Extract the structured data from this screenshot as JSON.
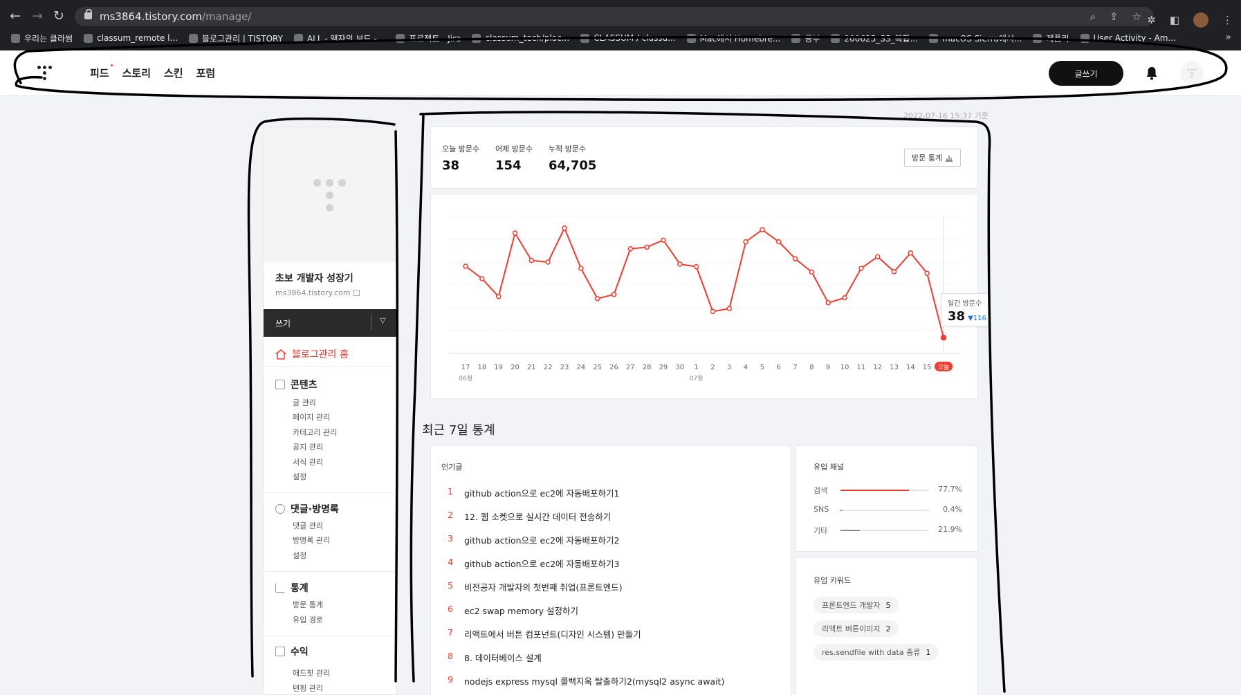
{
  "browser": {
    "url_host": "ms3864.tistory.com",
    "url_path": "/manage/",
    "bookmarks": [
      {
        "label": "우리는 클라썸"
      },
      {
        "label": "classum_remote l..."
      },
      {
        "label": "블로그관리 | TISTORY"
      },
      {
        "label": "ALL - 액자의 보드 -..."
      },
      {
        "label": "프로젝트 - Jira"
      },
      {
        "label": "classum_tech/plac..."
      },
      {
        "label": "CLASSUM / classu..."
      },
      {
        "label": "Mac에서 Homebre..."
      },
      {
        "label": "공부"
      },
      {
        "label": "200625_SS_복합..."
      },
      {
        "label": "macOS Sierra에서..."
      },
      {
        "label": "제품리"
      },
      {
        "label": "User Activity - Am..."
      }
    ],
    "bookmarks_more": "»"
  },
  "topnav": {
    "links": [
      "피드",
      "스토리",
      "스킨",
      "포럼"
    ],
    "write_button": "글쓰기"
  },
  "timestamp": "2022-07-16 15:37 기준",
  "sidebar": {
    "blog_name": "초보 개발자 성장기",
    "blog_url": "ms3864.tistory.com",
    "write_dropdown": "쓰기",
    "home": "블로그관리 홈",
    "sections": [
      {
        "title": "콘텐츠",
        "items": [
          "글 관리",
          "페이지 관리",
          "카테고리 관리",
          "공지 관리",
          "서식 관리",
          "설정"
        ]
      },
      {
        "title": "댓글·방명록",
        "items": [
          "댓글 관리",
          "방명록 관리",
          "설정"
        ]
      },
      {
        "title": "통계",
        "items": [
          "방문 통계",
          "유입 경로"
        ]
      },
      {
        "title": "수익",
        "items": [
          "애드핏 관리",
          "텐핑 관리"
        ]
      }
    ]
  },
  "summary": {
    "today_label": "오늘 방문수",
    "today_value": "38",
    "yesterday_label": "어제 방문수",
    "yesterday_value": "154",
    "total_label": "누적 방문수",
    "total_value": "64,705",
    "stats_button": "방문 통계"
  },
  "chart_data": {
    "type": "line",
    "x": [
      "17",
      "18",
      "19",
      "20",
      "21",
      "22",
      "23",
      "24",
      "25",
      "26",
      "27",
      "28",
      "29",
      "30",
      "1",
      "2",
      "3",
      "4",
      "5",
      "6",
      "7",
      "8",
      "9",
      "10",
      "11",
      "12",
      "13",
      "14",
      "15",
      "오늘"
    ],
    "month_labels": [
      {
        "at": "17",
        "label": "06월"
      },
      {
        "at": "1",
        "label": "07월"
      }
    ],
    "series": [
      {
        "values": [
          210,
          180,
          137,
          290,
          224,
          220,
          302,
          205,
          132,
          142,
          252,
          256,
          273,
          215,
          209,
          101,
          108,
          269,
          298,
          269,
          228,
          196,
          122,
          134,
          205,
          233,
          197,
          242,
          193,
          38
        ],
        "color": "#f53b2d"
      }
    ],
    "ylim": [
      0,
      330
    ],
    "grid": true,
    "tooltip": {
      "label": "일간 방문수",
      "value": "38",
      "delta": "▼116"
    }
  },
  "recent": {
    "title": "최근 7일 통계",
    "popular_title": "인기글",
    "posts": [
      {
        "rank": "1",
        "title": "github action으로 ec2에 자동배포하기1"
      },
      {
        "rank": "2",
        "title": "12. 웹 소켓으로 실시간 데이터 전송하기"
      },
      {
        "rank": "3",
        "title": "github action으로 ec2에 자동배포하기2"
      },
      {
        "rank": "4",
        "title": "github action으로 ec2에 자동배포하기3"
      },
      {
        "rank": "5",
        "title": "비전공자 개발자의 첫번째 취업(프론트엔드)"
      },
      {
        "rank": "6",
        "title": "ec2 swap memory 설정하기"
      },
      {
        "rank": "7",
        "title": "리액트에서 버튼 컴포넌트(디자인 시스템) 만들기"
      },
      {
        "rank": "8",
        "title": "8. 데이터베이스 설계"
      },
      {
        "rank": "9",
        "title": "nodejs express mysql 콜백지옥 탈출하기2(mysql2 async await)"
      }
    ],
    "channels_title": "유입 채널",
    "channels": [
      {
        "name": "검색",
        "pct": "77.7%",
        "value": 0.777,
        "color": "#f53b2d"
      },
      {
        "name": "SNS",
        "pct": "0.4%",
        "value": 0.004,
        "color": "#888888"
      },
      {
        "name": "기타",
        "pct": "21.9%",
        "value": 0.219,
        "color": "#888888"
      }
    ],
    "keywords_title": "유입 키워드",
    "keywords": [
      {
        "text": "프론트엔드 개발자",
        "count": "5"
      },
      {
        "text": "리액트 버튼이미지",
        "count": "2"
      },
      {
        "text": "res.sendfile with data 종류",
        "count": "1"
      }
    ]
  }
}
